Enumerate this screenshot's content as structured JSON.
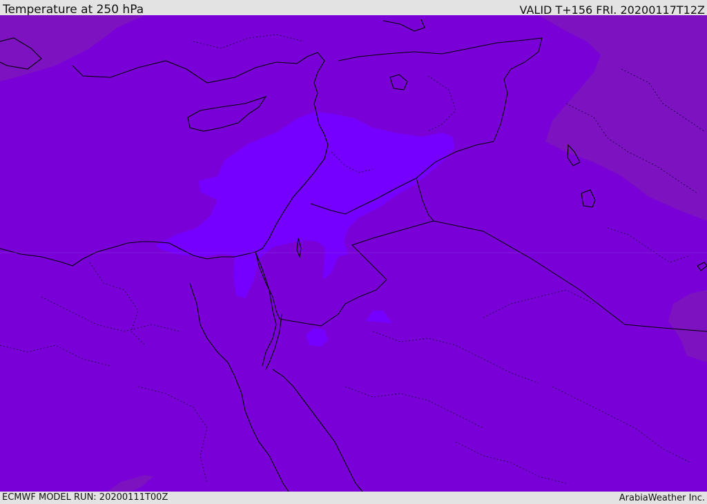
{
  "header": {
    "title": "Temperature at 250 hPa",
    "valid_time": "VALID T+156 FRI. 20200117T12Z"
  },
  "footer": {
    "model_run": "ECMWF MODEL RUN: 20200111T00Z",
    "credit": "ArabiaWeather Inc."
  },
  "colors": {
    "background_field": "#7a00d8",
    "warm_region": "#7c10c2",
    "cold_region": "#7500ff",
    "border": "#000000",
    "bar": "#e3e3e3"
  },
  "icons": [
    "coastline-lines",
    "country-borders",
    "province-borders"
  ]
}
